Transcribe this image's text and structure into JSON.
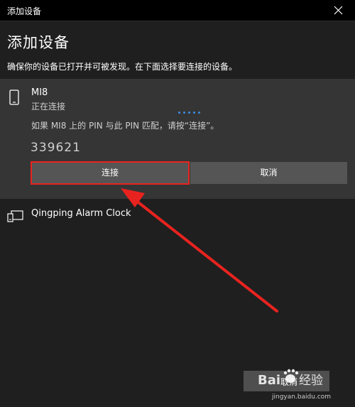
{
  "window": {
    "title": "添加设备"
  },
  "header": {
    "title": "添加设备",
    "subtitle": "确保你的设备已打开并可被发现。在下面选择要连接的设备。"
  },
  "device": {
    "icon": "phone-icon",
    "name": "MI8",
    "status": "正在连接",
    "pin_prompt": "如果 MI8 上的 PIN 与此 PIN 匹配，请按“连接”。",
    "pin": "339621",
    "connect_label": "连接",
    "cancel_label": "取消"
  },
  "other_devices": [
    {
      "icon": "display-icon",
      "name": "Qingping Alarm Clock"
    }
  ],
  "footer": {
    "cancel_label": "取消"
  },
  "watermark": {
    "logo_text": "Baidu经验",
    "url": "jingyan.baidu.com"
  },
  "colors": {
    "window_bg": "#1f1f1f",
    "panel_bg": "#353535",
    "button_bg": "#555555",
    "highlight": "#e8231f",
    "progress": "#3a8ee6"
  }
}
